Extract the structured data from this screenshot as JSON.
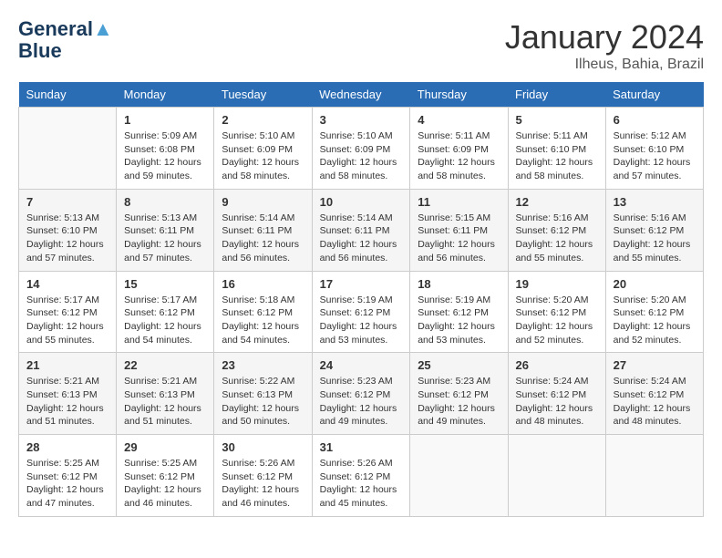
{
  "header": {
    "logo_line1": "General",
    "logo_line2": "Blue",
    "month": "January 2024",
    "location": "Ilheus, Bahia, Brazil"
  },
  "weekdays": [
    "Sunday",
    "Monday",
    "Tuesday",
    "Wednesday",
    "Thursday",
    "Friday",
    "Saturday"
  ],
  "weeks": [
    [
      {
        "day": "",
        "sunrise": "",
        "sunset": "",
        "daylight": ""
      },
      {
        "day": "1",
        "sunrise": "5:09 AM",
        "sunset": "6:08 PM",
        "daylight": "12 hours and 59 minutes."
      },
      {
        "day": "2",
        "sunrise": "5:10 AM",
        "sunset": "6:09 PM",
        "daylight": "12 hours and 58 minutes."
      },
      {
        "day": "3",
        "sunrise": "5:10 AM",
        "sunset": "6:09 PM",
        "daylight": "12 hours and 58 minutes."
      },
      {
        "day": "4",
        "sunrise": "5:11 AM",
        "sunset": "6:09 PM",
        "daylight": "12 hours and 58 minutes."
      },
      {
        "day": "5",
        "sunrise": "5:11 AM",
        "sunset": "6:10 PM",
        "daylight": "12 hours and 58 minutes."
      },
      {
        "day": "6",
        "sunrise": "5:12 AM",
        "sunset": "6:10 PM",
        "daylight": "12 hours and 57 minutes."
      }
    ],
    [
      {
        "day": "7",
        "sunrise": "5:13 AM",
        "sunset": "6:10 PM",
        "daylight": "12 hours and 57 minutes."
      },
      {
        "day": "8",
        "sunrise": "5:13 AM",
        "sunset": "6:11 PM",
        "daylight": "12 hours and 57 minutes."
      },
      {
        "day": "9",
        "sunrise": "5:14 AM",
        "sunset": "6:11 PM",
        "daylight": "12 hours and 56 minutes."
      },
      {
        "day": "10",
        "sunrise": "5:14 AM",
        "sunset": "6:11 PM",
        "daylight": "12 hours and 56 minutes."
      },
      {
        "day": "11",
        "sunrise": "5:15 AM",
        "sunset": "6:11 PM",
        "daylight": "12 hours and 56 minutes."
      },
      {
        "day": "12",
        "sunrise": "5:16 AM",
        "sunset": "6:12 PM",
        "daylight": "12 hours and 55 minutes."
      },
      {
        "day": "13",
        "sunrise": "5:16 AM",
        "sunset": "6:12 PM",
        "daylight": "12 hours and 55 minutes."
      }
    ],
    [
      {
        "day": "14",
        "sunrise": "5:17 AM",
        "sunset": "6:12 PM",
        "daylight": "12 hours and 55 minutes."
      },
      {
        "day": "15",
        "sunrise": "5:17 AM",
        "sunset": "6:12 PM",
        "daylight": "12 hours and 54 minutes."
      },
      {
        "day": "16",
        "sunrise": "5:18 AM",
        "sunset": "6:12 PM",
        "daylight": "12 hours and 54 minutes."
      },
      {
        "day": "17",
        "sunrise": "5:19 AM",
        "sunset": "6:12 PM",
        "daylight": "12 hours and 53 minutes."
      },
      {
        "day": "18",
        "sunrise": "5:19 AM",
        "sunset": "6:12 PM",
        "daylight": "12 hours and 53 minutes."
      },
      {
        "day": "19",
        "sunrise": "5:20 AM",
        "sunset": "6:12 PM",
        "daylight": "12 hours and 52 minutes."
      },
      {
        "day": "20",
        "sunrise": "5:20 AM",
        "sunset": "6:12 PM",
        "daylight": "12 hours and 52 minutes."
      }
    ],
    [
      {
        "day": "21",
        "sunrise": "5:21 AM",
        "sunset": "6:13 PM",
        "daylight": "12 hours and 51 minutes."
      },
      {
        "day": "22",
        "sunrise": "5:21 AM",
        "sunset": "6:13 PM",
        "daylight": "12 hours and 51 minutes."
      },
      {
        "day": "23",
        "sunrise": "5:22 AM",
        "sunset": "6:13 PM",
        "daylight": "12 hours and 50 minutes."
      },
      {
        "day": "24",
        "sunrise": "5:23 AM",
        "sunset": "6:12 PM",
        "daylight": "12 hours and 49 minutes."
      },
      {
        "day": "25",
        "sunrise": "5:23 AM",
        "sunset": "6:12 PM",
        "daylight": "12 hours and 49 minutes."
      },
      {
        "day": "26",
        "sunrise": "5:24 AM",
        "sunset": "6:12 PM",
        "daylight": "12 hours and 48 minutes."
      },
      {
        "day": "27",
        "sunrise": "5:24 AM",
        "sunset": "6:12 PM",
        "daylight": "12 hours and 48 minutes."
      }
    ],
    [
      {
        "day": "28",
        "sunrise": "5:25 AM",
        "sunset": "6:12 PM",
        "daylight": "12 hours and 47 minutes."
      },
      {
        "day": "29",
        "sunrise": "5:25 AM",
        "sunset": "6:12 PM",
        "daylight": "12 hours and 46 minutes."
      },
      {
        "day": "30",
        "sunrise": "5:26 AM",
        "sunset": "6:12 PM",
        "daylight": "12 hours and 46 minutes."
      },
      {
        "day": "31",
        "sunrise": "5:26 AM",
        "sunset": "6:12 PM",
        "daylight": "12 hours and 45 minutes."
      },
      {
        "day": "",
        "sunrise": "",
        "sunset": "",
        "daylight": ""
      },
      {
        "day": "",
        "sunrise": "",
        "sunset": "",
        "daylight": ""
      },
      {
        "day": "",
        "sunrise": "",
        "sunset": "",
        "daylight": ""
      }
    ]
  ]
}
